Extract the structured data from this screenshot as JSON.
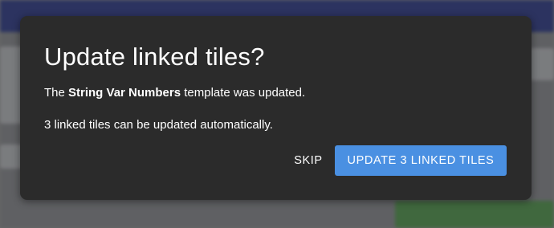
{
  "dialog": {
    "title": "Update linked tiles?",
    "message_prefix": "The ",
    "template_name": "String Var Numbers",
    "message_suffix": " template was updated.",
    "message_2": "3 linked tiles can be updated automatically.",
    "skip_label": "SKIP",
    "update_label": "UPDATE 3 LINKED TILES"
  },
  "colors": {
    "dialog_background": "#2b2b2b",
    "primary_button": "#4a90e2",
    "text": "#ffffff"
  }
}
